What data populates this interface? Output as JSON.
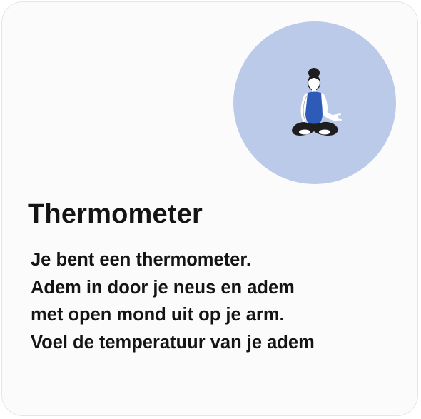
{
  "card": {
    "title": "Thermometer",
    "description_lines": [
      "Je bent een thermometer.",
      "Adem in door je neus en adem",
      "met open mond uit op je arm.",
      "Voel de temperatuur van je adem"
    ],
    "illustration_icon": "meditating-person-icon"
  },
  "colors": {
    "circle_background": "#bccae9",
    "shirt": "#2f5bb8",
    "hair_and_legs": "#1e1e1e",
    "text": "#141414"
  }
}
